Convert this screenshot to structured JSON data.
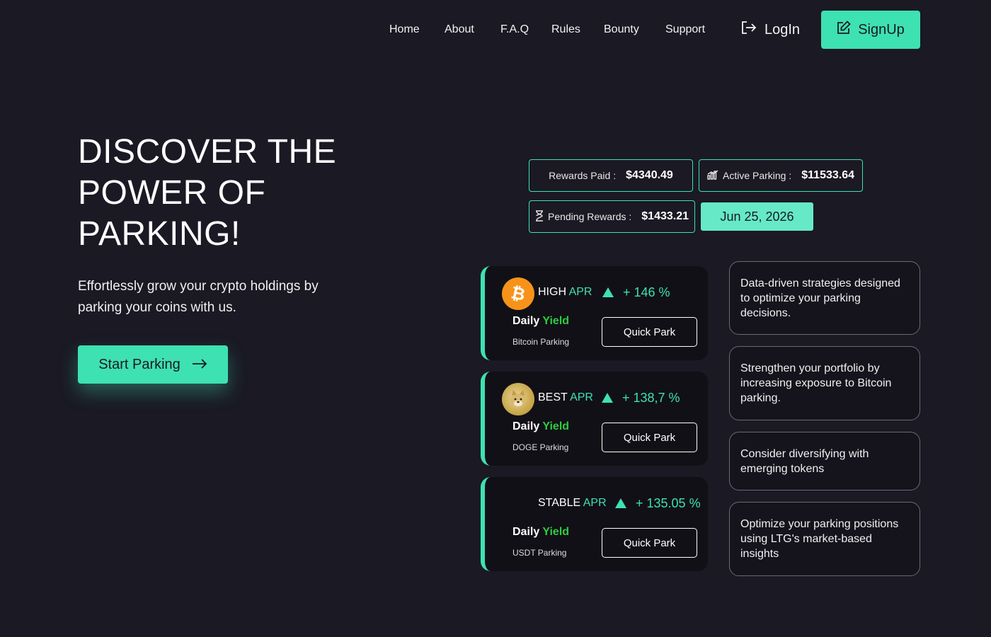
{
  "nav": {
    "links": [
      "Home",
      "About",
      "F.A.Q",
      "Rules",
      "Bounty",
      "Support"
    ],
    "login_label": "LogIn",
    "signup_label": "SignUp"
  },
  "hero": {
    "title": "DISCOVER THE POWER OF PARKING!",
    "subtitle": "Effortlessly grow your crypto holdings by parking your coins with us.",
    "cta_label": "Start Parking"
  },
  "stats": {
    "rewards_paid": {
      "label": "Rewards Paid :",
      "value": "$4340.49"
    },
    "active_parking": {
      "label": "Active Parking :",
      "value": "$11533.64"
    },
    "pending_rewards": {
      "label": "Pending Rewards :",
      "value": "$1433.21"
    },
    "date": "Jun 25, 2026"
  },
  "cards": [
    {
      "tier": "HIGH",
      "apr_word": "APR",
      "pct": "+ 146 %",
      "daily": "Daily",
      "yield": "Yield",
      "coin_label": "Bitcoin Parking",
      "button": "Quick Park",
      "icon": "bitcoin-icon"
    },
    {
      "tier": "BEST",
      "apr_word": "APR",
      "pct": "+ 138,7 %",
      "daily": "Daily",
      "yield": "Yield",
      "coin_label": "DOGE Parking",
      "button": "Quick Park",
      "icon": "doge-icon"
    },
    {
      "tier": "STABLE",
      "apr_word": "APR",
      "pct": "+ 135.05 %",
      "daily": "Daily",
      "yield": "Yield",
      "coin_label": "USDT Parking",
      "button": "Quick Park",
      "icon": ""
    }
  ],
  "tips": [
    "Data-driven strategies designed to optimize your parking decisions.",
    "Strengthen your portfolio by increasing exposure to Bitcoin parking.",
    "Consider diversifying with emerging tokens",
    "Optimize your parking positions using LTG's market-based insights"
  ],
  "colors": {
    "background": "#1a1924",
    "accent": "#3ee1b2",
    "yield": "#2ecc40"
  }
}
